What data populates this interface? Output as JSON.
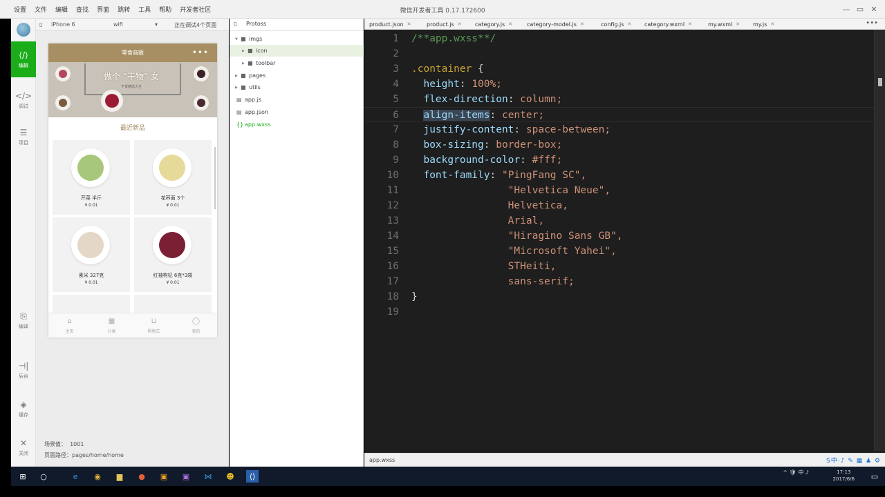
{
  "topbar": {
    "menu": [
      "设置",
      "文件",
      "编辑",
      "查找",
      "界面",
      "跳转",
      "工具",
      "帮助",
      "开发者社区"
    ],
    "title": "微信开发者工具 0.17.172600",
    "controls": [
      "—",
      "▭",
      "✕"
    ]
  },
  "leftbar": {
    "items": [
      {
        "label": "编辑",
        "icon": "⟨/⟩",
        "icon_name": "edit-icon",
        "active": true
      },
      {
        "label": "调试",
        "icon": "</>",
        "icon_name": "debug-icon",
        "active": false
      },
      {
        "label": "项目",
        "icon": "☰",
        "icon_name": "project-icon",
        "active": false
      },
      {
        "label": "编译",
        "icon": "⎘",
        "icon_name": "compile-icon",
        "active": false
      },
      {
        "label": "后台",
        "icon": "⊣|",
        "icon_name": "background-icon",
        "active": false
      },
      {
        "label": "缓存",
        "icon": "◈",
        "icon_name": "cache-icon",
        "active": false
      },
      {
        "label": "关闭",
        "icon": "✕",
        "icon_name": "close-icon",
        "active": false
      }
    ]
  },
  "simulator": {
    "device": "iPhone 6",
    "network": "wifi",
    "debug_status": "正在调试4个页面",
    "phone": {
      "nav_title": "零食商贩",
      "nav_dots": "•••",
      "banner_title": "做个 “干物” 女",
      "banner_sub": "干货精选大全",
      "section_title": "最近新品",
      "products": [
        {
          "name": "芹菜 半斤",
          "price": "¥ 0.01",
          "color": "#a7c77a"
        },
        {
          "name": "花荞面 3个",
          "price": "¥ 0.01",
          "color": "#e6d99a"
        },
        {
          "name": "素米 327克",
          "price": "¥ 0.01",
          "color": "#e5d7c7"
        },
        {
          "name": "红袖枸杞 6克*3袋",
          "price": "¥ 0.01",
          "color": "#7a1f34"
        }
      ],
      "tabs": [
        {
          "label": "主页",
          "icon": "⌂",
          "icon_name": "home-icon"
        },
        {
          "label": "分类",
          "icon": "▦",
          "icon_name": "category-icon"
        },
        {
          "label": "购物车",
          "icon": "⊔",
          "icon_name": "cart-icon"
        },
        {
          "label": "我的",
          "icon": "◯",
          "icon_name": "profile-icon"
        }
      ]
    },
    "scene_label": "场景值：",
    "scene_value": "1001",
    "path_label": "页面路径：",
    "path_value": "pages/home/home"
  },
  "filetree": {
    "project": "Protoss",
    "rows": [
      {
        "name": "imgs",
        "type": "folder",
        "level": 0,
        "expanded": true,
        "selected": false
      },
      {
        "name": "icon",
        "type": "folder",
        "level": 1,
        "expanded": false,
        "selected": true
      },
      {
        "name": "toolbar",
        "type": "folder",
        "level": 1,
        "expanded": false,
        "selected": false
      },
      {
        "name": "pages",
        "type": "folder",
        "level": 0,
        "expanded": false,
        "selected": false
      },
      {
        "name": "utils",
        "type": "folder",
        "level": 0,
        "expanded": false,
        "selected": false
      },
      {
        "name": "app.js",
        "type": "file",
        "level": 0,
        "selected": false
      },
      {
        "name": "app.json",
        "type": "file",
        "level": 0,
        "selected": false
      },
      {
        "name": "app.wxss",
        "type": "style",
        "level": 0,
        "selected": false
      }
    ]
  },
  "editor": {
    "tabs": [
      "product.json",
      "product.js",
      "category.js",
      "category-model.js",
      "config.js",
      "category.wxml",
      "my.wxml",
      "my.js"
    ],
    "more": "•••",
    "status_file": "app.wxss",
    "ime": "S中·♪ ✎ ▦ ♟ ⚙",
    "current_line": 6,
    "lines": [
      {
        "n": "1",
        "t": "/**app.wxss**/"
      },
      {
        "n": "2",
        "t": ""
      },
      {
        "n": "3",
        "t": ".container {"
      },
      {
        "n": "4",
        "t": "  height: 100%;"
      },
      {
        "n": "5",
        "t": "  flex-direction: column;"
      },
      {
        "n": "6",
        "t": "  align-items: center;"
      },
      {
        "n": "7",
        "t": "  justify-content: space-between;"
      },
      {
        "n": "8",
        "t": "  box-sizing: border-box;"
      },
      {
        "n": "9",
        "t": "  background-color: #fff;"
      },
      {
        "n": "10",
        "t": "  font-family: \"PingFang SC\","
      },
      {
        "n": "11",
        "t": "                \"Helvetica Neue\","
      },
      {
        "n": "12",
        "t": "                Helvetica,"
      },
      {
        "n": "13",
        "t": "                Arial,"
      },
      {
        "n": "14",
        "t": "                \"Hiragino Sans GB\","
      },
      {
        "n": "15",
        "t": "                \"Microsoft Yahei\","
      },
      {
        "n": "16",
        "t": "                STHeiti,"
      },
      {
        "n": "17",
        "t": "                sans-serif;"
      },
      {
        "n": "18",
        "t": "}"
      },
      {
        "n": "19",
        "t": ""
      }
    ]
  },
  "taskbar": {
    "tray": "^ 🛡 中 ♪",
    "time": "17:13",
    "date": "2017/6/6"
  },
  "colors": {
    "accent_green": "#1aad19",
    "nav_brown": "#a78f63",
    "editor_bg": "#1e1e1e"
  }
}
